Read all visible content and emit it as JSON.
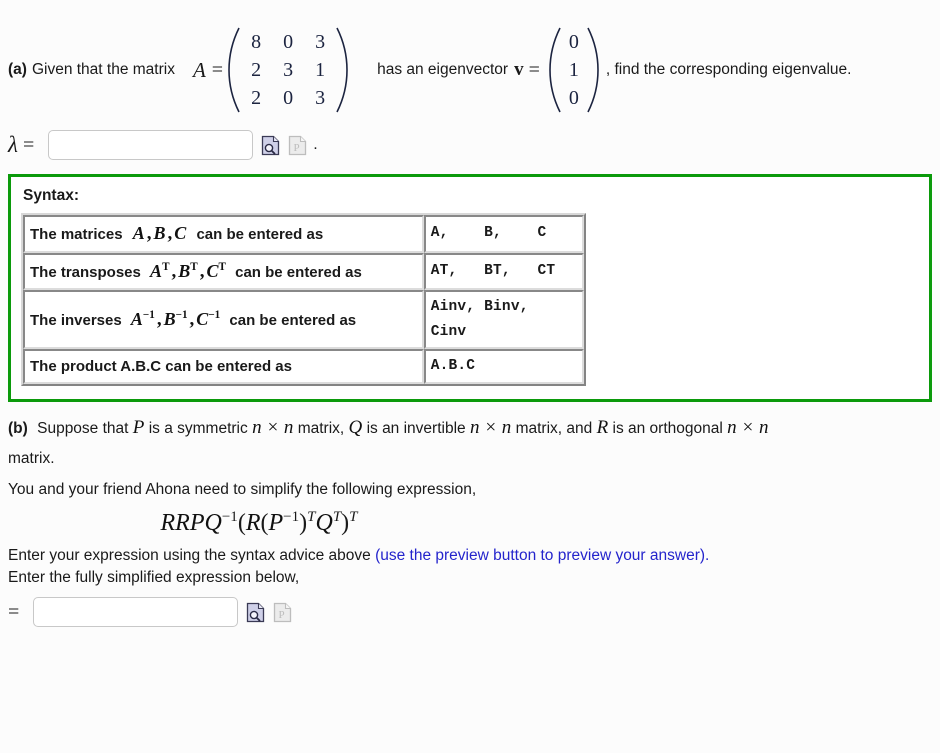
{
  "part_a": {
    "label": "(a)",
    "text_before_matrix": "Given that the matrix",
    "matrix_name": "A",
    "equals": "=",
    "matrix_A": {
      "rows": 3,
      "cols": 3,
      "values": [
        [
          8,
          0,
          3
        ],
        [
          2,
          3,
          1
        ],
        [
          2,
          0,
          3
        ]
      ]
    },
    "text_middle": "has an eigenvector",
    "vector_name": "v",
    "vector_v": {
      "rows": 3,
      "cols": 1,
      "values": [
        [
          0
        ],
        [
          1
        ],
        [
          0
        ]
      ]
    },
    "text_after": ", find the corresponding eigenvalue.",
    "answer": {
      "symbol": "λ",
      "equals": "=",
      "value": "",
      "placeholder": "",
      "preview_icon": "preview-document-magnifier-icon",
      "print_icon": "print-document-p-icon",
      "trailing_punctuation": "."
    }
  },
  "syntax_box": {
    "title": "Syntax:",
    "border_color": "#0b9a0b",
    "rows": [
      {
        "description_prefix": "The matrices",
        "description_math": "A, B, C",
        "description_suffix": "can be entered as",
        "code": "A,    B,    C"
      },
      {
        "description_prefix": "The transposes",
        "description_math": "A^T, B^T, C^T",
        "description_suffix": "can be entered as",
        "code": "AT,   BT,   CT"
      },
      {
        "description_prefix": "The inverses",
        "description_math": "A^-1, B^-1, C^-1",
        "description_suffix": "can be entered as",
        "code": "Ainv, Binv,\nCinv"
      },
      {
        "description_prefix": "The product A.B.C can be entered as",
        "description_math": "",
        "description_suffix": "",
        "code": "A.B.C"
      }
    ]
  },
  "part_b": {
    "label": "(b)",
    "line1_a": "Suppose that",
    "sym_P": "P",
    "line1_b": "is a symmetric",
    "dim1": "n × n",
    "line1_c": "matrix,",
    "sym_Q": "Q",
    "line1_d": "is an invertible",
    "dim2": "n × n",
    "line1_e": "matrix, and",
    "sym_R": "R",
    "line1_f": "is an orthogonal",
    "dim3": "n × n",
    "line2": "matrix.",
    "line3": "You and your friend Ahona need to simplify the following expression,",
    "expression": "RRPQ⁻¹(R(P⁻¹)ᵀQᵀ)ᵀ",
    "line4_black": "Enter your expression using the syntax advice above",
    "line4_blue": "(use the preview button to preview your answer).",
    "line5": "Enter the fully simplified expression below,",
    "answer": {
      "equals": "=",
      "value": "",
      "placeholder": "",
      "preview_icon": "preview-document-magnifier-icon",
      "print_icon": "print-document-p-icon"
    }
  },
  "colors": {
    "page_background": "#fcfcfc",
    "green_border": "#0b9a0b",
    "link_blue": "#2424cc",
    "math_navy": "#1c2440"
  }
}
